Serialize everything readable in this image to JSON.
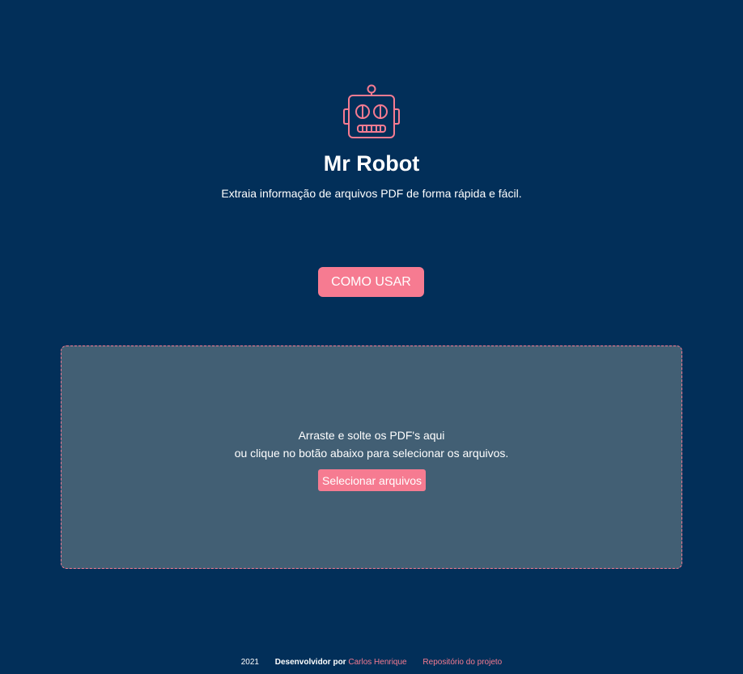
{
  "colors": {
    "background": "#022f59",
    "accent": "#f67b91",
    "dropzone": "#425f74",
    "text": "#ffffff"
  },
  "header": {
    "logo_icon": "robot-icon",
    "title": "Mr Robot",
    "subtitle": "Extraia informação de arquivos PDF de forma rápida e fácil."
  },
  "how_to_use": {
    "label": "Como usar"
  },
  "dropzone": {
    "line1": "Arraste e solte os PDF's aqui",
    "line2": "ou clique no botão abaixo para selecionar os arquivos.",
    "button_label": "Selecionar arquivos"
  },
  "footer": {
    "year": "2021",
    "developed_by": "Desenvolvidor por",
    "author": "Carlos Henrique",
    "repo_link": "Repositório do projeto"
  }
}
